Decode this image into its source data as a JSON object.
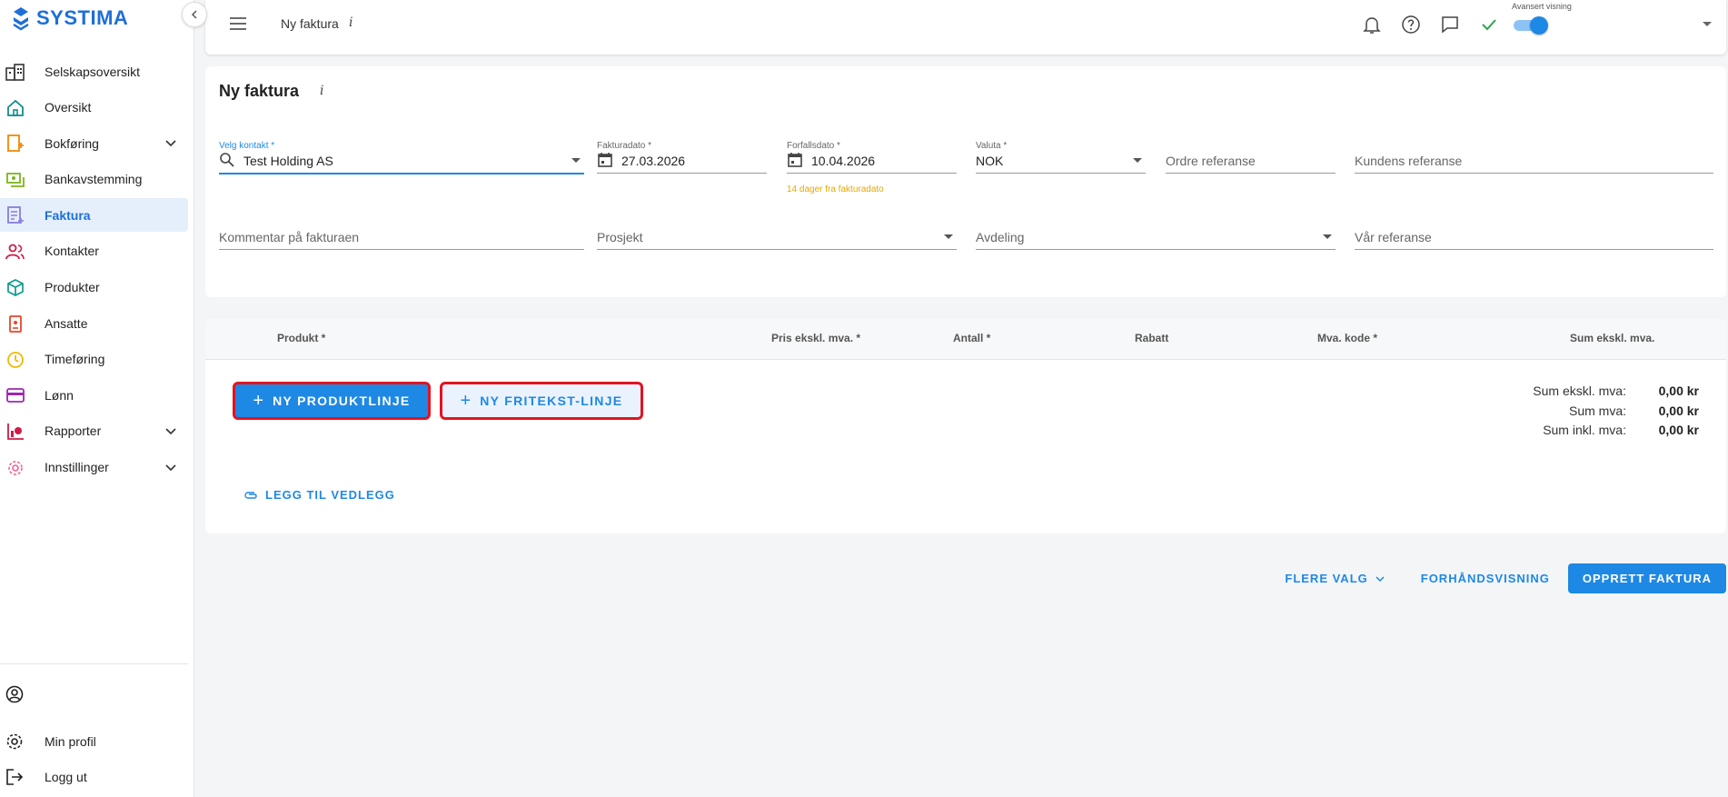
{
  "brand": {
    "name": "SYSTIMA",
    "color": "#1e6fd9"
  },
  "sidebar": {
    "items": [
      {
        "label": "Selskapsoversikt",
        "icon": "buildings-icon"
      },
      {
        "label": "Oversikt",
        "icon": "home-icon"
      },
      {
        "label": "Bokføring",
        "icon": "ledger-icon",
        "expandable": true
      },
      {
        "label": "Bankavstemming",
        "icon": "bank-icon"
      },
      {
        "label": "Faktura",
        "icon": "invoice-icon",
        "active": true
      },
      {
        "label": "Kontakter",
        "icon": "people-icon"
      },
      {
        "label": "Produkter",
        "icon": "box-icon"
      },
      {
        "label": "Ansatte",
        "icon": "badge-icon"
      },
      {
        "label": "Timeføring",
        "icon": "clock-icon"
      },
      {
        "label": "Lønn",
        "icon": "card-icon"
      },
      {
        "label": "Rapporter",
        "icon": "chart-icon",
        "expandable": true
      },
      {
        "label": "Innstillinger",
        "icon": "gear-icon",
        "expandable": true
      }
    ],
    "bottom": [
      {
        "label": "",
        "icon": "account-circle-icon"
      },
      {
        "label": "Min profil",
        "icon": "settings-icon"
      },
      {
        "label": "Logg ut",
        "icon": "logout-icon"
      }
    ]
  },
  "topbar": {
    "title": "Ny faktura",
    "info": "i",
    "advanced_label": "Avansert visning",
    "advanced_on": true
  },
  "form": {
    "title": "Ny faktura",
    "info": "i",
    "contact": {
      "label": "Velg kontakt *",
      "value": "Test Holding AS"
    },
    "invoice_date": {
      "label": "Fakturadato *",
      "value": "27.03.2026"
    },
    "due_date": {
      "label": "Forfallsdato *",
      "value": "10.04.2026",
      "hint": "14 dager fra fakturadato"
    },
    "currency": {
      "label": "Valuta *",
      "value": "NOK"
    },
    "order_ref": {
      "placeholder": "Ordre referanse"
    },
    "customer_ref": {
      "placeholder": "Kundens referanse"
    },
    "comment": {
      "placeholder": "Kommentar på fakturaen"
    },
    "project": {
      "placeholder": "Prosjekt"
    },
    "department": {
      "placeholder": "Avdeling"
    },
    "our_ref": {
      "placeholder": "Vår referanse"
    }
  },
  "lines": {
    "columns": [
      "Produkt *",
      "Pris ekskl. mva. *",
      "Antall *",
      "Rabatt",
      "Mva. kode *",
      "Sum ekskl. mva."
    ],
    "add_product_label": "NY PRODUKTLINJE",
    "add_freetext_label": "NY FRITEKST-LINJE",
    "attach_label": "LEGG TIL VEDLEGG",
    "sums": [
      {
        "label": "Sum ekskl. mva:",
        "value": "0,00 kr"
      },
      {
        "label": "Sum mva:",
        "value": "0,00 kr"
      },
      {
        "label": "Sum inkl. mva:",
        "value": "0,00 kr"
      }
    ]
  },
  "actions": {
    "more": "FLERE VALG",
    "preview": "FORHÅNDSVISNING",
    "create": "OPPRETT FAKTURA"
  },
  "colors": {
    "accent": "#1e88e5",
    "highlight": "#e3141f",
    "hint": "#e6a700"
  }
}
